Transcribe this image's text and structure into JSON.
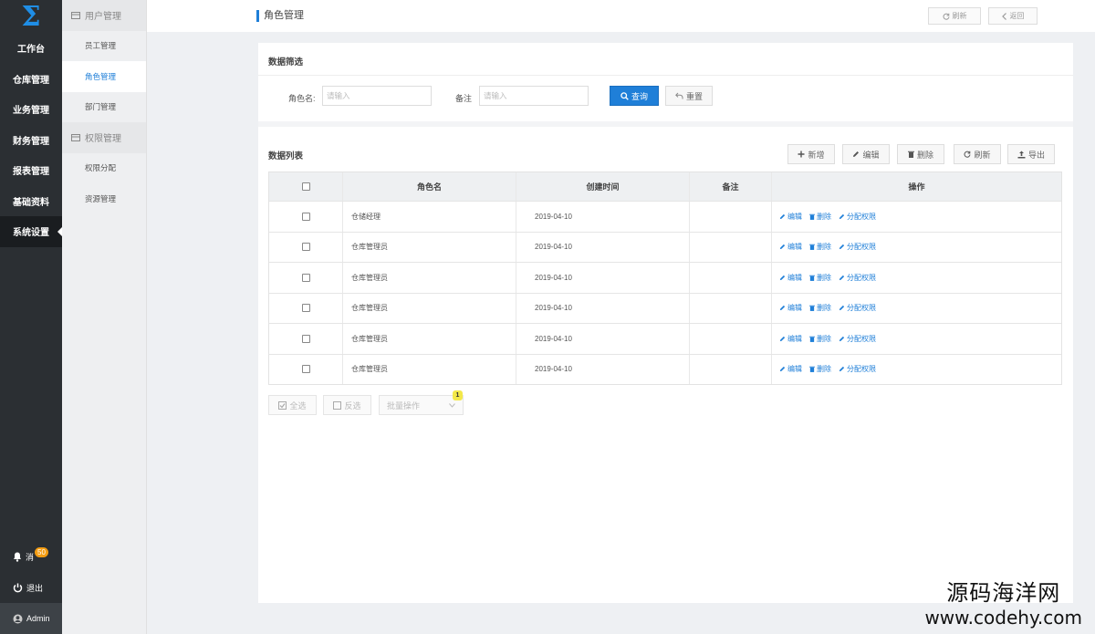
{
  "nav": {
    "logo": "Σ",
    "items": [
      "工作台",
      "仓库管理",
      "业务管理",
      "财务管理",
      "报表管理",
      "基础资料",
      "系统设置"
    ],
    "message_label": "消",
    "message_count": "50",
    "logout_label": "退出",
    "user_label": "Admin"
  },
  "submenu": {
    "group1": "用户管理",
    "group1_items": [
      "员工管理",
      "角色管理",
      "部门管理"
    ],
    "group2": "权限管理",
    "group2_items": [
      "权限分配",
      "资源管理"
    ]
  },
  "topbar": {
    "title": "角色管理",
    "refresh_label": "刷新",
    "back_label": "返回"
  },
  "filter": {
    "title": "数据筛选",
    "role_label": "角色名:",
    "role_placeholder": "请输入",
    "remark_label": "备注",
    "remark_placeholder": "请输入",
    "search_label": "查询",
    "reset_label": "重置"
  },
  "list": {
    "title": "数据列表",
    "toolbar": [
      "新增",
      "编辑",
      "删除",
      "刷新",
      "导出"
    ],
    "columns": [
      "角色名",
      "创建时间",
      "备注",
      "操作"
    ],
    "rows": [
      {
        "name": "仓储经理",
        "date": "2019-04-10",
        "remark": ""
      },
      {
        "name": "仓库管理员",
        "date": "2019-04-10",
        "remark": ""
      },
      {
        "name": "仓库管理员",
        "date": "2019-04-10",
        "remark": ""
      },
      {
        "name": "仓库管理员",
        "date": "2019-04-10",
        "remark": ""
      },
      {
        "name": "仓库管理员",
        "date": "2019-04-10",
        "remark": ""
      },
      {
        "name": "仓库管理员",
        "date": "2019-04-10",
        "remark": ""
      }
    ],
    "row_actions": [
      "编辑",
      "删除",
      "分配权限"
    ]
  },
  "bottom": {
    "select_all": "全选",
    "invert": "反选",
    "batch_placeholder": "批量操作",
    "badge": "1"
  },
  "watermark": {
    "line1": "源码海洋网",
    "line2": "www.codehy.com"
  },
  "colors": {
    "accent": "#1f7fd8",
    "nav_bg": "#2b2f33",
    "badge": "#f39c12"
  }
}
